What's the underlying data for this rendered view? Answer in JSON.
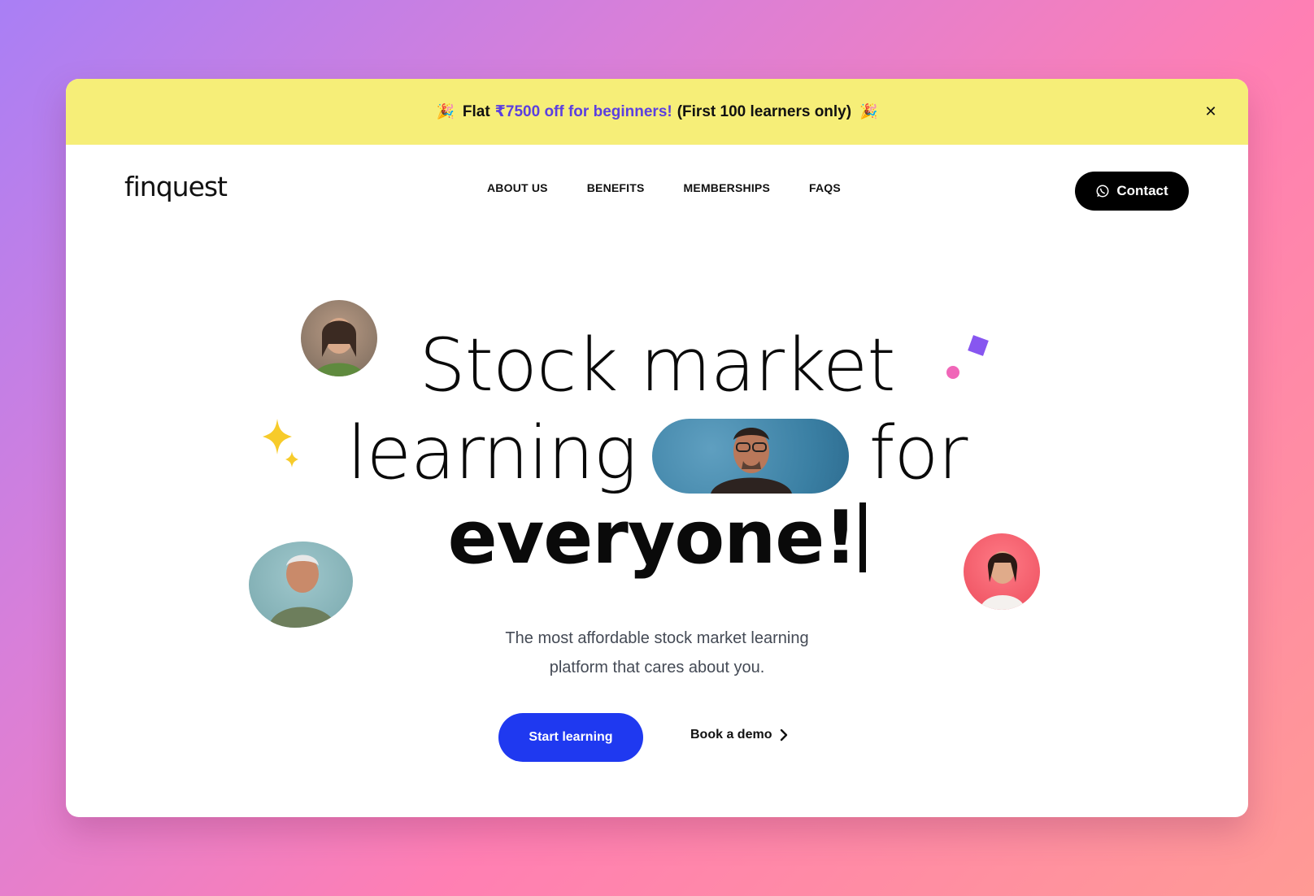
{
  "promo": {
    "emoji_left": "🎉",
    "lead": "Flat",
    "highlight": "₹7500 off for beginners!",
    "tail": "(First 100 learners only)",
    "emoji_right": "🎉",
    "close_glyph": "✕",
    "highlight_color": "#5b3fe0",
    "background": "#f6ee78"
  },
  "nav": {
    "logo": "finquest",
    "links": [
      "ABOUT US",
      "BENEFITS",
      "MEMBERSHIPS",
      "FAQS"
    ],
    "contact_label": "Contact",
    "contact_icon": "whatsapp-icon"
  },
  "hero": {
    "line1": "Stock market",
    "line2_left": "learning",
    "line2_right": "for",
    "line3": "everyone!",
    "subtitle_line1": "The most affordable stock market learning",
    "subtitle_line2": "platform that cares about you."
  },
  "cta": {
    "primary": "Start learning",
    "primary_color": "#1f39f0",
    "secondary": "Book a demo",
    "secondary_icon": "chevron-right-icon"
  }
}
